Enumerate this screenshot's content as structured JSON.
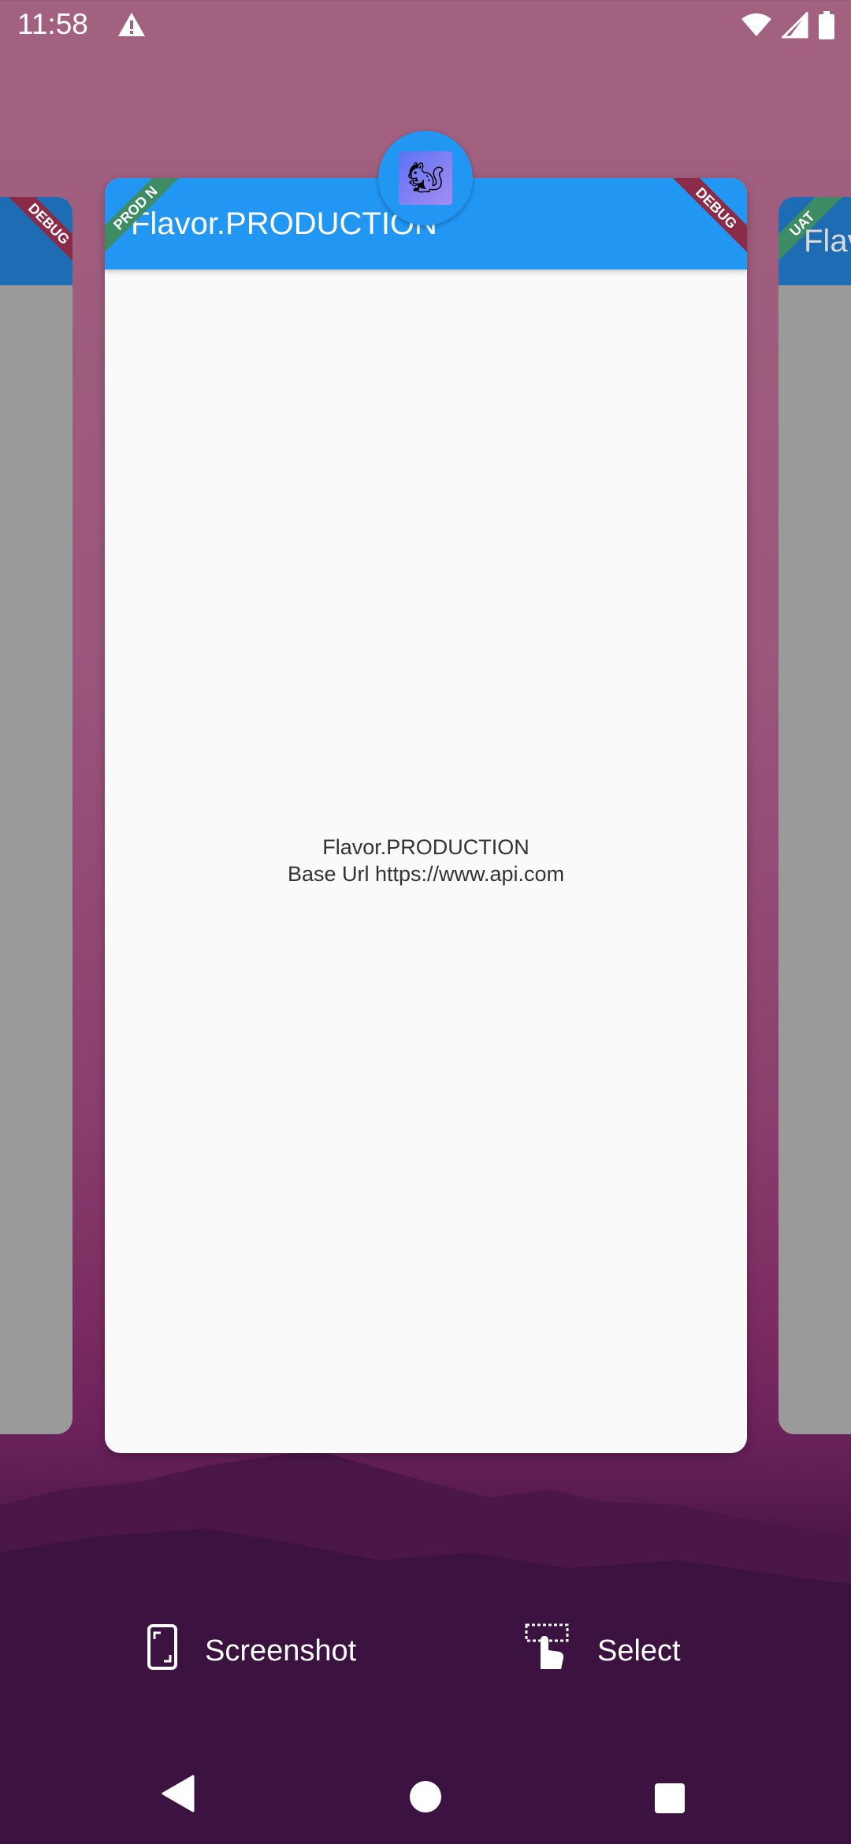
{
  "status_bar": {
    "time": "11:58",
    "icons": [
      "warning-icon",
      "wifi-icon",
      "cell-signal-icon",
      "battery-icon"
    ]
  },
  "recents": {
    "main_card": {
      "app_bar_title": "Flavor.PRODUCTION",
      "ribbon_left": "PROD N",
      "ribbon_right": "DEBUG",
      "body_line1": "Flavor.PRODUCTION",
      "body_line2": "Base Url https://www.api.com",
      "app_icon": "squirrel-icon"
    },
    "left_card": {
      "ribbon": "DEBUG"
    },
    "right_card": {
      "ribbon": "UAT",
      "title_fragment": "Flav"
    }
  },
  "actions": {
    "screenshot_label": "Screenshot",
    "select_label": "Select"
  },
  "nav": {
    "back": "back-icon",
    "home": "home-icon",
    "recents": "recents-icon"
  },
  "colors": {
    "app_bar": "#2196f3",
    "ribbon_green": "#3d8c63",
    "ribbon_red": "#8a2b48"
  }
}
